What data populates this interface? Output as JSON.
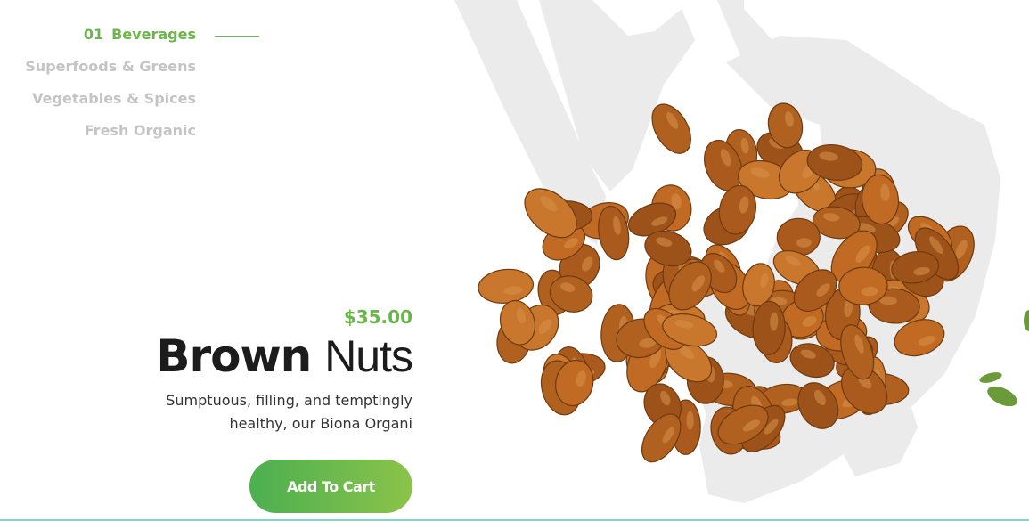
{
  "categories": [
    {
      "number": "01",
      "label": "Beverages",
      "active": true
    },
    {
      "number": "",
      "label": "Superfoods & Greens",
      "active": false
    },
    {
      "number": "",
      "label": "Vegetables & Spices",
      "active": false
    },
    {
      "number": "",
      "label": "Fresh Organic",
      "active": false
    }
  ],
  "product": {
    "price": "$35.00",
    "title_bold": "Brown",
    "title_light": "Nuts",
    "description_line1": "Sumptuous, filling, and temptingly",
    "description_line2": "healthy, our Biona Organi",
    "cta_label": "Add To Cart"
  },
  "colors": {
    "accent": "#6bb64a",
    "inactive_nav": "#c4c4c4",
    "button_gradient_start": "#4caf50",
    "button_gradient_end": "#8bc34a",
    "brush_background": "#ebebeb",
    "nut": "#b8631f",
    "bottom_line": "#7fd8c9"
  }
}
